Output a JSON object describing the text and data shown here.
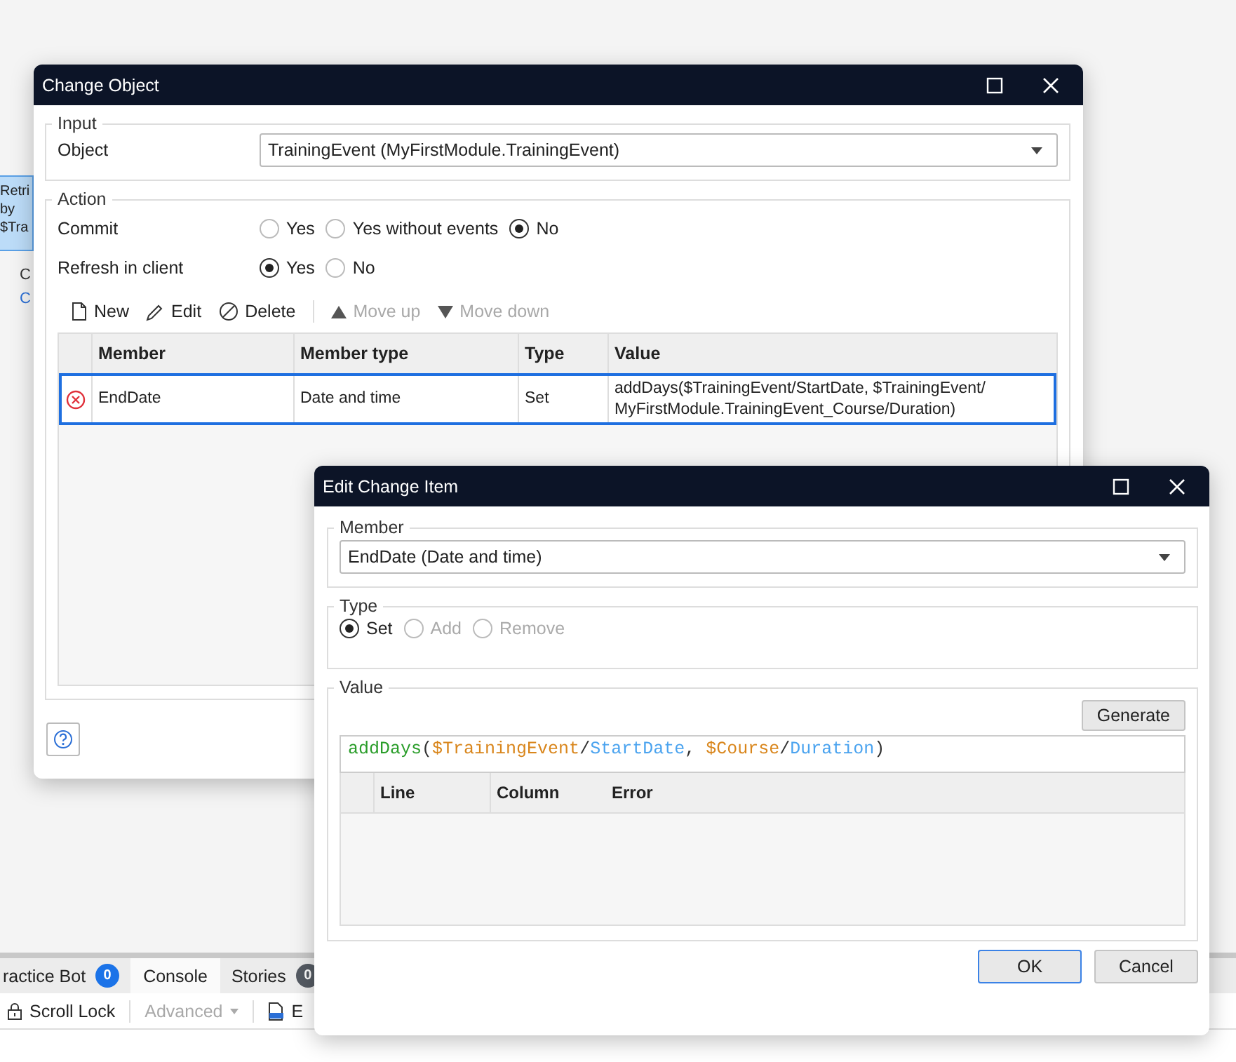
{
  "canvas": {
    "node_lines": [
      "Retri",
      "by",
      "$Tra"
    ],
    "captions": [
      {
        "text": "C",
        "color": "#333333"
      },
      {
        "text": "C",
        "color": "#2b6fd6"
      }
    ]
  },
  "bottom_panel": {
    "tabs": [
      {
        "label": "ractice Bot",
        "badge": "0",
        "color": "#1b73e8",
        "selected": false
      },
      {
        "label": "Console",
        "selected": true
      },
      {
        "label": "Stories",
        "badge": "0",
        "color": "#555b63",
        "selected": false
      }
    ],
    "toolbar": [
      {
        "label": "Scroll Lock",
        "kind": "lock",
        "disabled": false
      },
      {
        "label": "Advanced",
        "kind": "dropdown",
        "disabled": true
      },
      {
        "label": "E",
        "kind": "csv",
        "disabled": false
      }
    ]
  },
  "change_object": {
    "title": "Change Object",
    "input": {
      "legend": "Input",
      "label": "Object",
      "value": "TrainingEvent (MyFirstModule.TrainingEvent)"
    },
    "action": {
      "legend": "Action",
      "groups": [
        {
          "label": "Commit",
          "options": [
            {
              "label": "Yes",
              "selected": false
            },
            {
              "label": "Yes without events",
              "selected": false
            },
            {
              "label": "No",
              "selected": true
            }
          ]
        },
        {
          "label": "Refresh in client",
          "options": [
            {
              "label": "Yes",
              "selected": true
            },
            {
              "label": "No",
              "selected": false
            }
          ]
        }
      ],
      "toolbar": [
        {
          "label": "New",
          "kind": "new",
          "disabled": false
        },
        {
          "label": "Edit",
          "kind": "edit",
          "disabled": false
        },
        {
          "label": "Delete",
          "kind": "delete",
          "disabled": false
        },
        {
          "label": "Move up",
          "kind": "up",
          "disabled": true
        },
        {
          "label": "Move down",
          "kind": "down",
          "disabled": true
        }
      ],
      "table": {
        "columns": [
          "Member",
          "Member type",
          "Type",
          "Value"
        ],
        "rows": [
          {
            "error": true,
            "selected": true,
            "cells": [
              "EndDate",
              "Date and time",
              "Set",
              "addDays($TrainingEvent/StartDate, $TrainingEvent/ MyFirstModule.TrainingEvent_Course/Duration)"
            ]
          }
        ]
      }
    }
  },
  "edit_change_item": {
    "title": "Edit Change Item",
    "member": {
      "legend": "Member",
      "value": "EndDate (Date and time)"
    },
    "type": {
      "legend": "Type",
      "options": [
        {
          "label": "Set",
          "selected": true,
          "disabled": false
        },
        {
          "label": "Add",
          "selected": false,
          "disabled": true
        },
        {
          "label": "Remove",
          "selected": false,
          "disabled": true
        }
      ]
    },
    "value": {
      "legend": "Value",
      "generate": "Generate",
      "tokens": [
        {
          "text": "addDays",
          "kind": "function"
        },
        {
          "text": "(",
          "kind": "punct"
        },
        {
          "text": "$TrainingEvent",
          "kind": "variable"
        },
        {
          "text": "/",
          "kind": "punct"
        },
        {
          "text": "StartDate",
          "kind": "attribute"
        },
        {
          "text": ", ",
          "kind": "punct"
        },
        {
          "text": "$Course",
          "kind": "variable"
        },
        {
          "text": "/",
          "kind": "punct"
        },
        {
          "text": "Duration",
          "kind": "attribute"
        },
        {
          "text": ")",
          "kind": "punct"
        }
      ],
      "error_columns": [
        "Line",
        "Column",
        "Error"
      ]
    },
    "buttons": [
      {
        "label": "OK",
        "default": true
      },
      {
        "label": "Cancel",
        "default": false
      }
    ]
  }
}
